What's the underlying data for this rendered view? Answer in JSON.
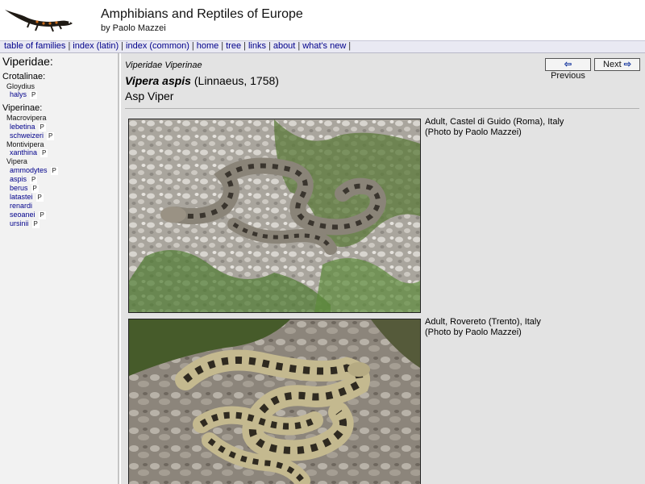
{
  "header": {
    "title": "Amphibians and Reptiles of Europe",
    "subtitle": "by Paolo Mazzei"
  },
  "nav": {
    "items": [
      "table of families",
      "index (latin)",
      "index (common)",
      "home",
      "tree",
      "links",
      "about",
      "what's new"
    ]
  },
  "sidebar": {
    "family": "Viperidae:",
    "subfamilies": [
      {
        "label": "Crotalinae:"
      },
      {
        "label": "Viperinae:"
      }
    ],
    "genera": [
      "Gloydius",
      "Macrovipera",
      "Montivipera",
      "Vipera"
    ],
    "species": [
      {
        "name": "halys",
        "badge": "P"
      },
      {
        "name": "lebetina",
        "badge": "P"
      },
      {
        "name": "schweizeri",
        "badge": "P"
      },
      {
        "name": "xanthina",
        "badge": "P"
      },
      {
        "name": "ammodytes",
        "badge": "P"
      },
      {
        "name": "aspis",
        "badge": "P"
      },
      {
        "name": "berus",
        "badge": "P"
      },
      {
        "name": "latastei",
        "badge": "P"
      },
      {
        "name": "renardi",
        "badge": ""
      },
      {
        "name": "seoanei",
        "badge": "P"
      },
      {
        "name": "ursinii",
        "badge": "P"
      }
    ]
  },
  "main": {
    "breadcrumb": "Viperidae Viperinae",
    "species_name": "Vipera aspis",
    "author": "(Linnaeus, 1758)",
    "common_name": "Asp Viper",
    "prev_label": "Previous",
    "next_label": "Next",
    "prev_arrow": "⇦",
    "next_arrow": "⇨",
    "photos": [
      {
        "caption": "Adult, Castel di Guido (Roma), Italy",
        "credit": "(Photo by Paolo Mazzei)"
      },
      {
        "caption": "Adult, Rovereto (Trento), Italy",
        "credit": "(Photo by Paolo Mazzei)"
      }
    ]
  },
  "colors": {
    "link": "#00008b",
    "nav_bg": "#e9e9f3",
    "sidebar_bg": "#f2f2f2",
    "main_bg": "#e3e3e3"
  }
}
